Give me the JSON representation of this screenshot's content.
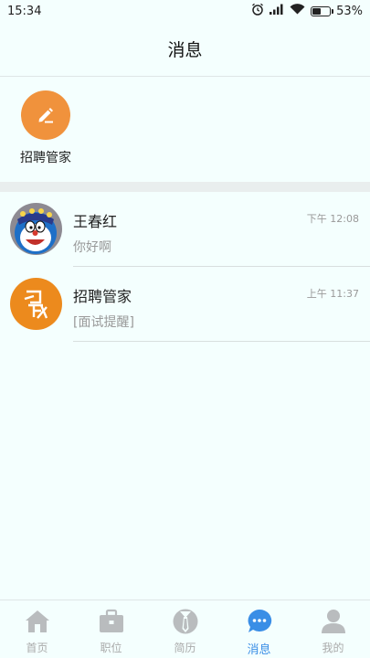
{
  "status_bar": {
    "time": "15:34",
    "battery": "53%",
    "battery_level": 0.53,
    "icons": [
      "alarm-icon",
      "signal-icon",
      "wifi-icon",
      "battery-icon"
    ]
  },
  "header": {
    "title": "消息"
  },
  "quick": {
    "items": [
      {
        "label": "招聘管家",
        "icon": "edit-icon",
        "color": "#f0923c"
      }
    ]
  },
  "messages": [
    {
      "name": "王春红",
      "time": "下午 12:08",
      "preview": "你好啊",
      "avatar": "doraemon-avatar"
    },
    {
      "name": "招聘管家",
      "time": "上午 11:37",
      "preview": "[面试提醒]",
      "avatar": "logo-avatar",
      "avatar_color": "#ec8a1d"
    }
  ],
  "bottom_nav": {
    "items": [
      {
        "label": "首页",
        "icon": "home-icon"
      },
      {
        "label": "职位",
        "icon": "briefcase-icon"
      },
      {
        "label": "简历",
        "icon": "tie-icon"
      },
      {
        "label": "消息",
        "icon": "chat-icon",
        "active": true
      },
      {
        "label": "我的",
        "icon": "user-icon"
      }
    ],
    "active_color": "#3a8ee6",
    "inactive_color": "#aaaaaa"
  }
}
